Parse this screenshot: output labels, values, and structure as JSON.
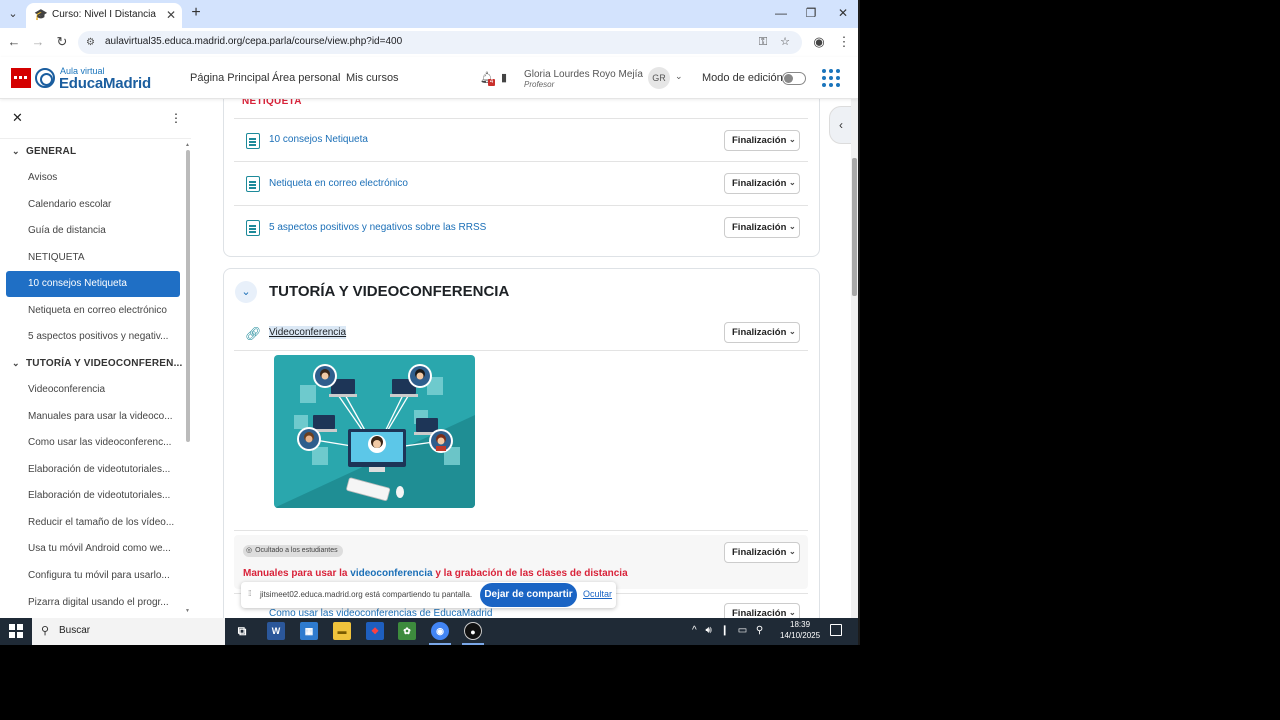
{
  "browser": {
    "tab_title": "Curso: Nivel I Distancia | AulaV",
    "new_tab": "+",
    "url": "aulavirtual35.educa.madrid.org/cepa.parla/course/view.php?id=400",
    "window_controls": {
      "minimize": "—",
      "maximize": "❐",
      "close": "✕"
    }
  },
  "header": {
    "logo_small": "Aula virtual",
    "logo_big": "EducaMadrid",
    "nav": [
      "Página Principal",
      "Área personal",
      "Mis cursos"
    ],
    "notification_count": "4",
    "user_name": "Gloria Lourdes Royo Mejía",
    "user_role": "Profesor",
    "avatar_initials": "GR",
    "edit_mode_label": "Modo de edición",
    "edit_mode_on": false
  },
  "sidebar": {
    "sections": [
      {
        "title": "GENERAL",
        "items": [
          "Avisos",
          "Calendario escolar",
          "Guía de distancia",
          "NETIQUETA",
          "10 consejos Netiqueta",
          "Netiqueta en correo electrónico",
          "5 aspectos positivos y negativ..."
        ]
      },
      {
        "title": "TUTORÍA Y VIDEOCONFEREN...",
        "items": [
          "Videoconferencia",
          "Manuales para usar la videoco...",
          "Como usar las videoconferenc...",
          "Elaboración de videotutoriales...",
          "Elaboración de videotutoriales...",
          "Reducir el tamaño de los vídeo...",
          "Usa tu móvil Android como we...",
          "Configura tu móvil para usarlo...",
          "Pizarra digital usando el progr..."
        ]
      }
    ],
    "active_item": "10 consejos Netiqueta"
  },
  "main": {
    "section1_title": "NETIQUETA",
    "section1_activities": [
      "10 consejos Netiqueta",
      "Netiqueta en correo electrónico",
      "5 aspectos positivos y negativos sobre las RRSS"
    ],
    "completion_label": "Finalización",
    "section2_title": "TUTORÍA Y VIDEOCONFERENCIA",
    "section2_first_activity": "Videoconferencia",
    "hidden_badge": "Ocultado a los estudiantes",
    "manual_red1": "Manuales para usar la ",
    "manual_blue": "videoconferencia",
    "manual_red2": " y la grabación de las clases de distancia",
    "last_activity": "Como usar las videoconferencias de EducaMadrid"
  },
  "share_bar": {
    "text": "jitsimeet02.educa.madrid.org está compartiendo tu pantalla.",
    "stop_label": "Dejar de compartir",
    "hide_label": "Ocultar"
  },
  "taskbar": {
    "search_label": "Buscar",
    "time": "18:39",
    "date": "14/10/2025"
  },
  "colors": {
    "brand_blue": "#1b5e9f",
    "active_item": "#1f6fc5",
    "section_red": "#d9233a",
    "activity_icon": "#1d8a9a"
  }
}
